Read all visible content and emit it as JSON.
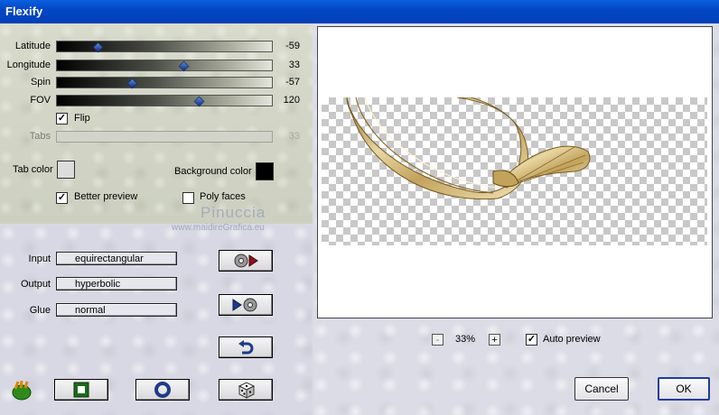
{
  "window": {
    "title": "Flexify"
  },
  "sliders": [
    {
      "label": "Latitude",
      "value": "-59",
      "fraction": 0.19
    },
    {
      "label": "Longitude",
      "value": "33",
      "fraction": 0.59
    },
    {
      "label": "Spin",
      "value": "-57",
      "fraction": 0.35
    },
    {
      "label": "FOV",
      "value": "120",
      "fraction": 0.66
    },
    {
      "label": "Tabs",
      "value": "33",
      "fraction": 0.0
    }
  ],
  "flip": {
    "label": "Flip",
    "checked": true
  },
  "tab_color": {
    "label": "Tab color",
    "color": "#dcdcdc"
  },
  "background_color": {
    "label": "Background color",
    "color": "#000000"
  },
  "better_preview": {
    "label": "Better preview",
    "checked": true
  },
  "poly_faces": {
    "label": "Poly faces",
    "checked": false
  },
  "watermark": {
    "name": "Pinuccia",
    "url": "www.maidireGrafica.eu"
  },
  "projection": {
    "input_label": "Input",
    "input_value": "equirectangular",
    "output_label": "Output",
    "output_value": "hyperbolic",
    "glue_label": "Glue",
    "glue_value": "normal"
  },
  "preview": {
    "zoom_minus": "-",
    "zoom_value": "33%",
    "zoom_plus": "+",
    "auto_preview": {
      "label": "Auto preview",
      "checked": true
    }
  },
  "dialog": {
    "cancel_label": "Cancel",
    "ok_label": "OK"
  },
  "colors": {
    "titlebar": "#0346c4",
    "slider_thumb": "#1b4fb0",
    "ribbon": "#c9b072"
  }
}
